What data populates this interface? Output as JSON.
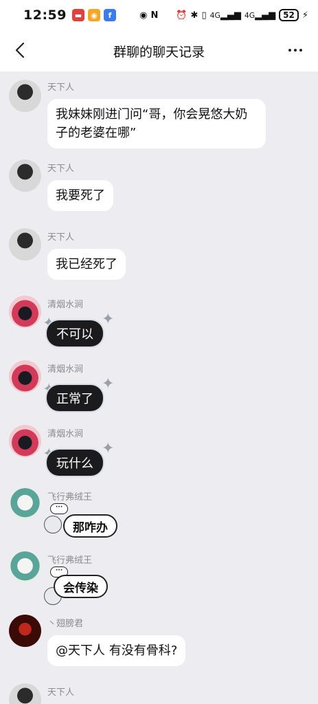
{
  "status_bar": {
    "time": "12:59",
    "network_1": "4G",
    "network_2": "4G",
    "battery": "52"
  },
  "nav": {
    "title": "群聊的聊天记录"
  },
  "messages": [
    {
      "sender": "天下人",
      "text": "我妹妹刚进门问“哥，你会晃悠大奶子的老婆在哪”",
      "avatar": "avatar-tianxiaren"
    },
    {
      "sender": "天下人",
      "text": "我要死了",
      "avatar": "avatar-tianxiaren"
    },
    {
      "sender": "天下人",
      "text": "我已经死了",
      "avatar": "avatar-tianxiaren"
    },
    {
      "sender": "清烟水涧",
      "text": "不可以",
      "avatar": "avatar-qingyan"
    },
    {
      "sender": "清烟水涧",
      "text": "正常了",
      "avatar": "avatar-qingyan"
    },
    {
      "sender": "清烟水涧",
      "text": "玩什么",
      "avatar": "avatar-qingyan"
    },
    {
      "sender": "飞行弗绒王",
      "text": "那咋办",
      "dots": "···",
      "avatar": "avatar-feixing"
    },
    {
      "sender": "飞行弗绒王",
      "text": "会传染",
      "dots": "···",
      "avatar": "avatar-feixing"
    },
    {
      "sender": "丶翅膀君",
      "text": "@天下人 有没有骨科?",
      "avatar": "avatar-chibang"
    },
    {
      "sender": "天下人",
      "avatar": "avatar-tianxiaren"
    }
  ],
  "colors": {
    "background": "#ececf1",
    "bubble": "#ffffff",
    "sender_name": "#8a8a90"
  }
}
